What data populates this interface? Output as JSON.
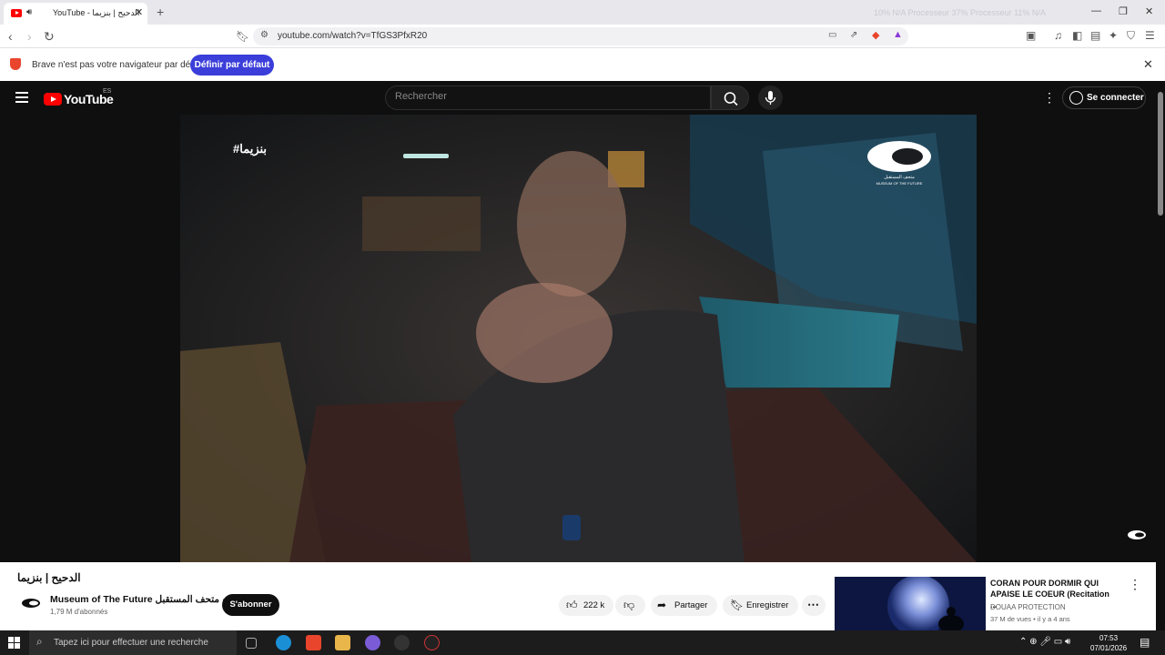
{
  "browser": {
    "tab_title": "YouTube - الدحيح | بنزيما",
    "address": "youtube.com/watch?v=TfGS3PfxR20",
    "sysmon_text": "10% N/A   Processeur   37%   Processeur 11%   N/A",
    "notice_text": "Brave n'est pas votre navigateur par défaut",
    "notice_button": "Définir par défaut"
  },
  "youtube": {
    "logo": "YouTube",
    "country": "ES",
    "search_placeholder": "Rechercher",
    "signin": "Se connecter",
    "video": {
      "overlay_tag": "#بنزيما",
      "brand_ar": "متحف المستقبل",
      "brand_en": "MUSEUM OF THE FUTURE"
    },
    "title": "الدحيح | بنزيما",
    "channel": "Museum of The Future متحف المستقبل",
    "subscribers": "1,79 M d'abonnés",
    "subscribe": "S'abonner",
    "likes": "222 k",
    "share": "Partager",
    "save": "Enregistrer",
    "recommended": {
      "title": "CORAN POUR DORMIR QUI APAISE LE COEUR (Recitation ...",
      "channel": "DOUAA PROTECTION",
      "meta": "37 M de vues • il y a 4 ans"
    }
  },
  "taskbar": {
    "search": "Tapez ici pour effectuer une recherche",
    "time": "07:53",
    "date": "07/01/2026"
  }
}
